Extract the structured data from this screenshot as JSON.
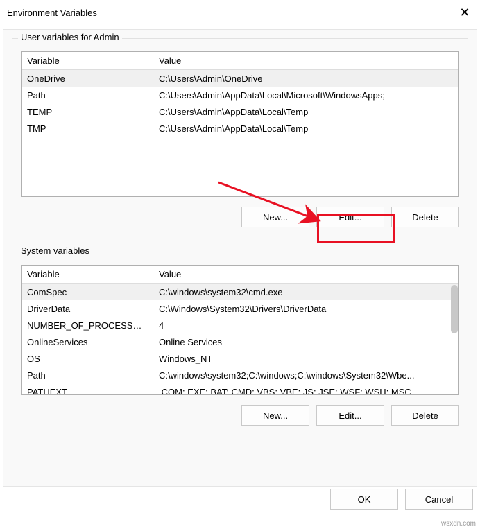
{
  "window": {
    "title": "Environment Variables"
  },
  "userGroup": {
    "label": "User variables for Admin",
    "headers": {
      "variable": "Variable",
      "value": "Value"
    },
    "rows": [
      {
        "variable": "OneDrive",
        "value": "C:\\Users\\Admin\\OneDrive",
        "selected": true
      },
      {
        "variable": "Path",
        "value": "C:\\Users\\Admin\\AppData\\Local\\Microsoft\\WindowsApps;",
        "selected": false
      },
      {
        "variable": "TEMP",
        "value": "C:\\Users\\Admin\\AppData\\Local\\Temp",
        "selected": false
      },
      {
        "variable": "TMP",
        "value": "C:\\Users\\Admin\\AppData\\Local\\Temp",
        "selected": false
      }
    ],
    "buttons": {
      "new": "New...",
      "edit": "Edit...",
      "delete": "Delete"
    }
  },
  "sysGroup": {
    "label": "System variables",
    "headers": {
      "variable": "Variable",
      "value": "Value"
    },
    "rows": [
      {
        "variable": "ComSpec",
        "value": "C:\\windows\\system32\\cmd.exe",
        "selected": true
      },
      {
        "variable": "DriverData",
        "value": "C:\\Windows\\System32\\Drivers\\DriverData",
        "selected": false
      },
      {
        "variable": "NUMBER_OF_PROCESSORS",
        "value": "4",
        "selected": false
      },
      {
        "variable": "OnlineServices",
        "value": "Online Services",
        "selected": false
      },
      {
        "variable": "OS",
        "value": "Windows_NT",
        "selected": false
      },
      {
        "variable": "Path",
        "value": "C:\\windows\\system32;C:\\windows;C:\\windows\\System32\\Wbe...",
        "selected": false
      },
      {
        "variable": "PATHEXT",
        "value": ".COM;.EXE;.BAT;.CMD;.VBS;.VBE;.JS;.JSE;.WSF;.WSH;.MSC",
        "selected": false
      }
    ],
    "buttons": {
      "new": "New...",
      "edit": "Edit...",
      "delete": "Delete"
    }
  },
  "footer": {
    "ok": "OK",
    "cancel": "Cancel"
  },
  "watermark": "wsxdn.com",
  "annotation": {
    "highlight_color": "#e81123"
  }
}
